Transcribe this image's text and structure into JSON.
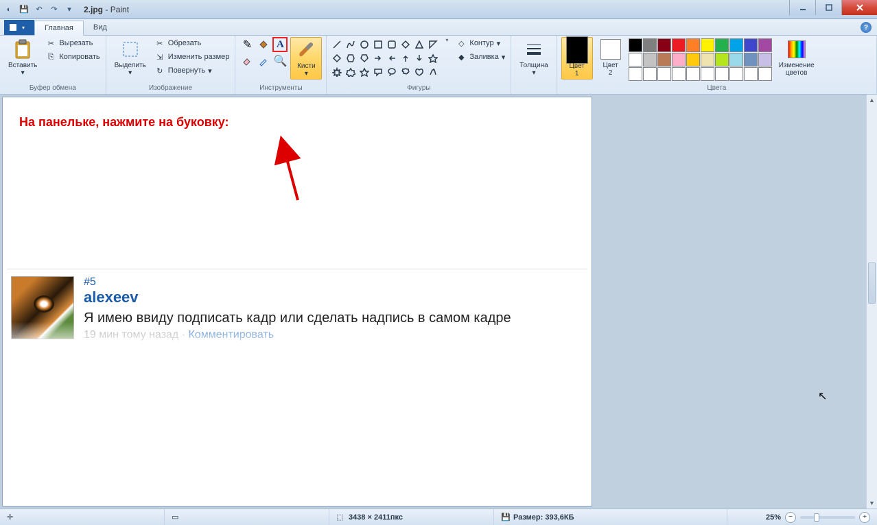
{
  "title": {
    "file": "2.jpg",
    "app": "Paint"
  },
  "tabs": {
    "file": "",
    "home": "Главная",
    "view": "Вид"
  },
  "ribbon": {
    "clipboard": {
      "paste": "Вставить",
      "cut": "Вырезать",
      "copy": "Копировать",
      "label": "Буфер обмена"
    },
    "image": {
      "select": "Выделить",
      "crop": "Обрезать",
      "resize": "Изменить размер",
      "rotate": "Повернуть",
      "label": "Изображение"
    },
    "tools": {
      "label": "Инструменты"
    },
    "brushes": {
      "btn": "Кисти"
    },
    "shapes": {
      "outline": "Контур",
      "fill": "Заливка",
      "label": "Фигуры"
    },
    "thickness": {
      "btn": "Толщина"
    },
    "colors": {
      "c1": "Цвет\n1",
      "c2": "Цвет\n2",
      "edit": "Изменение\nцветов",
      "label": "Цвета",
      "palette": [
        "#000000",
        "#7f7f7f",
        "#880015",
        "#ed1c24",
        "#ff7f27",
        "#fff200",
        "#22b14c",
        "#00a2e8",
        "#3f48cc",
        "#a349a4",
        "#ffffff",
        "#c3c3c3",
        "#b97a57",
        "#ffaec9",
        "#ffc90e",
        "#efe4b0",
        "#b5e61d",
        "#99d9ea",
        "#7092be",
        "#c8bfe7",
        "#ffffff",
        "#ffffff",
        "#ffffff",
        "#ffffff",
        "#ffffff",
        "#ffffff",
        "#ffffff",
        "#ffffff",
        "#ffffff",
        "#ffffff"
      ]
    }
  },
  "canvas": {
    "annotation": "На панельке, нажмите на буковку:",
    "comment": {
      "number": "#5",
      "user": "alexeev",
      "message": "Я имею ввиду подписать кадр или сделать надпись в самом кадре",
      "time": "19 мин тому назад",
      "sep": " · ",
      "action": "Комментировать"
    }
  },
  "status": {
    "dimensions": "3438 × 2411пкс",
    "size_label": "Размер:",
    "size_value": "393,6КБ",
    "zoom": "25%"
  }
}
